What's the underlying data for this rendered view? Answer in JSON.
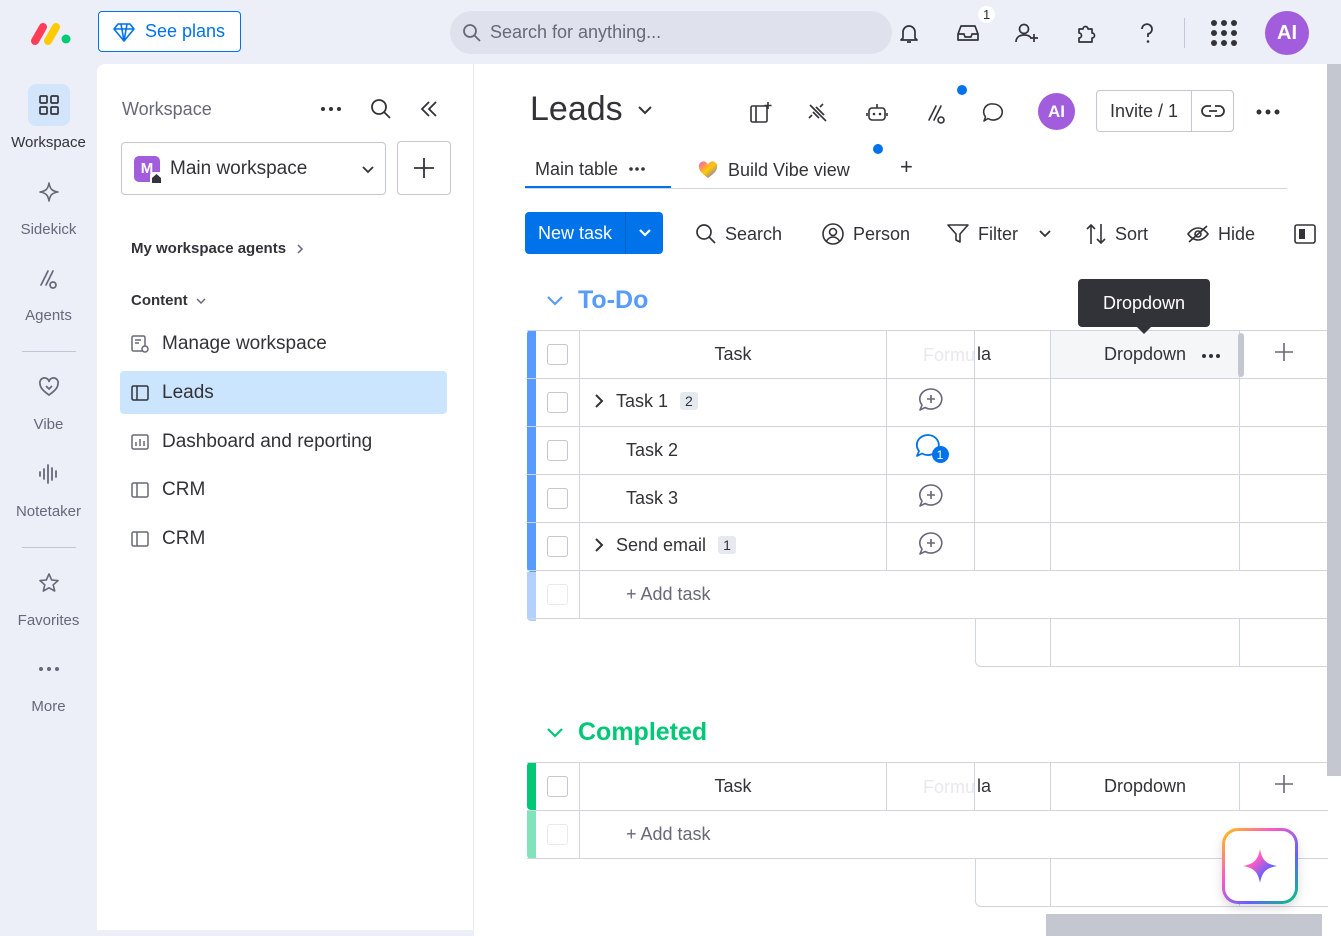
{
  "topbar": {
    "see_plans": "See plans",
    "search_placeholder": "Search for anything...",
    "inbox_badge": "1",
    "avatar": "AI"
  },
  "rail": {
    "items": [
      {
        "label": "Workspace"
      },
      {
        "label": "Sidekick"
      },
      {
        "label": "Agents"
      },
      {
        "label": "Vibe"
      },
      {
        "label": "Notetaker"
      },
      {
        "label": "Favorites"
      },
      {
        "label": "More"
      }
    ]
  },
  "workspace": {
    "title": "Workspace",
    "selected": "Main workspace",
    "selected_initial": "M",
    "agents_label": "My workspace agents",
    "content_label": "Content",
    "items": [
      {
        "label": "Manage workspace"
      },
      {
        "label": "Leads"
      },
      {
        "label": "Dashboard and reporting"
      },
      {
        "label": "CRM"
      },
      {
        "label": "CRM"
      }
    ]
  },
  "board": {
    "title": "Leads",
    "invite": "Invite / 1",
    "avatar": "AI",
    "tabs": [
      {
        "label": "Main table"
      },
      {
        "label": "Build Vibe view"
      }
    ],
    "add_tab": "+",
    "toolbar": {
      "new_task": "New task",
      "search": "Search",
      "person": "Person",
      "filter": "Filter",
      "sort": "Sort",
      "hide": "Hide"
    },
    "tooltip": "Dropdown",
    "groups": [
      {
        "title": "To-Do",
        "color": "#579bfc",
        "columns": {
          "task": "Task",
          "formula_ghost": "Formu",
          "formula_tail": "la",
          "dropdown": "Dropdown"
        },
        "rows": [
          {
            "name": "Task 1",
            "subitems": "2",
            "updates": ""
          },
          {
            "name": "Task 2",
            "subitems": "",
            "updates": "1"
          },
          {
            "name": "Task 3",
            "subitems": "",
            "updates": ""
          },
          {
            "name": "Send email",
            "subitems": "1",
            "updates": ""
          }
        ],
        "add_task": "+ Add task"
      },
      {
        "title": "Completed",
        "color": "#00c875",
        "columns": {
          "task": "Task",
          "formula_ghost": "Formu",
          "formula_tail": "la",
          "dropdown": "Dropdown"
        },
        "rows": [],
        "add_task": "+ Add task"
      }
    ]
  }
}
